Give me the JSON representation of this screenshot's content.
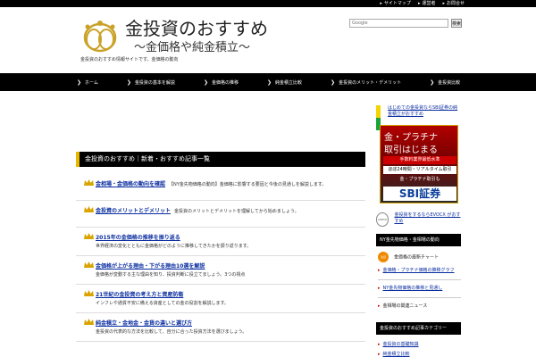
{
  "topbar": {
    "links": [
      "サイトマップ",
      "運営者",
      "お問合せ"
    ]
  },
  "header": {
    "title": "金投資のおすすめ",
    "subtitle": "〜金価格や純金積立〜",
    "tagline": "金投資のおすすめ情報サイトです。金価格の動向",
    "search_placeholder": "Google",
    "search_button": "検索"
  },
  "nav": {
    "items": [
      "ホーム",
      "金投資の基本を解説",
      "金価格の推移",
      "純金積立比較",
      "金投資のメリット・デメリット",
      "金投資比較"
    ]
  },
  "main": {
    "section_title": "金投資のおすすめ｜新着・おすすめ記事一覧",
    "articles": [
      {
        "title": "金相場・金価格の動向を確認",
        "desc": "【NY金先物価格の動向】金価格に影響する要因と今後の見通しを解説します。",
        "inline": true
      },
      {
        "title": "金投資のメリットとデメリット",
        "desc": "金投資のメリットとデメリットを理解してから始めましょう。",
        "inline": true
      },
      {
        "title": "2015年の金価格の推移を振り返る",
        "desc": "世界経済の変化とともに金価格がどのように推移してきたかを振り返ります。",
        "inline": false
      },
      {
        "title": "金価格が上がる理由・下がる理由10選を解説",
        "desc": "金価格が変動する主な理由を知り、投資判断に役立てましょう。3つの視点",
        "inline": false
      },
      {
        "title": "21世紀の金投資の考え方と資産防衛",
        "desc": "インフレや通貨不安に備える資産としての金の役割を解説します。",
        "inline": false
      },
      {
        "title": "純金積立・金地金・金貨の違いと選び方",
        "desc": "金投資の代表的な方法を比較して、自分に合った投資方法を選びましょう。",
        "inline": false
      }
    ]
  },
  "sidebar": {
    "beginner_link": "はじめての金投資ならSBI証券の純金積立がおすすめ",
    "ad": {
      "line1": "金・プラチナ",
      "line2": "取引はじまる",
      "line3": "手数料業界最低水準",
      "line4": "ほぼ24時間・リアルタイム取引",
      "line5": "金・プラチナ取引も",
      "line6": "SBI証券"
    },
    "check_label": "CHECK",
    "check_link": "金投資をするならEVOCX がおすすめ",
    "widget1_title": "NY金先物価格・金相場の動向",
    "widget1_badge": "注目",
    "widget1_badge_text": "金価格の最新チャート",
    "widget1_links": [
      "金価格・プラチナ価格の推移グラフ",
      "NY金先物価格の推移と見通し"
    ],
    "widget1_plain": "金相場の関連ニュース",
    "widget2_title": "金投資のおすすめ記事カテゴリー",
    "widget2_links": [
      "金投資の基礎知識",
      "純金積立比較"
    ]
  }
}
